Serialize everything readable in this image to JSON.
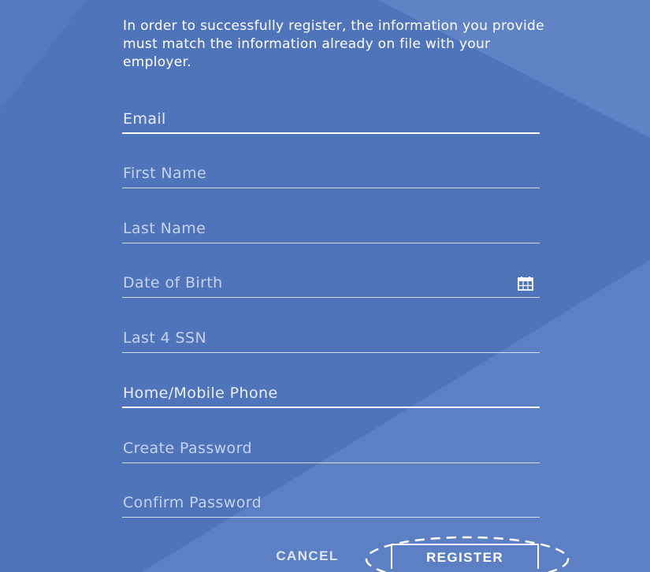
{
  "intro_text": "In order to successfully register, the information you provide must match the information already on file with your employer.",
  "fields": {
    "email": {
      "placeholder": "Email"
    },
    "first_name": {
      "placeholder": "First Name"
    },
    "last_name": {
      "placeholder": "Last Name"
    },
    "date_of_birth": {
      "placeholder": "Date of Birth",
      "icon": "calendar-icon"
    },
    "last4_ssn": {
      "placeholder": "Last 4 SSN"
    },
    "phone": {
      "placeholder": "Home/Mobile Phone"
    },
    "create_password": {
      "placeholder": "Create Password"
    },
    "confirm_password": {
      "placeholder": "Confirm Password"
    }
  },
  "actions": {
    "cancel_label": "CANCEL",
    "register_label": "REGISTER"
  },
  "colors": {
    "background": "#4f74b9",
    "text": "#ffffff",
    "placeholder": "#c5d3ec"
  }
}
